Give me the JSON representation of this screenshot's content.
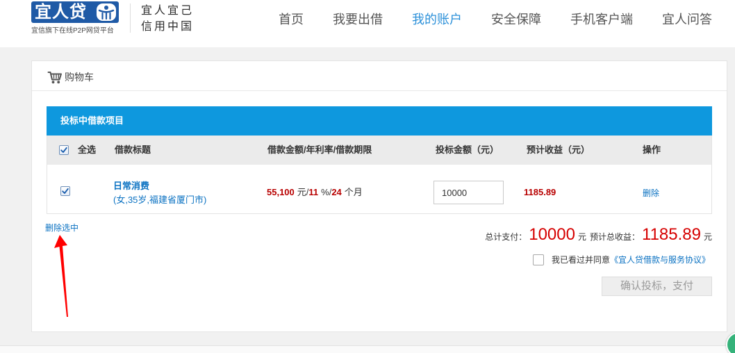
{
  "colors": {
    "brand": "#1f5aa6",
    "nav-active": "#2b90d9",
    "section-bar": "#0e98de",
    "link": "#0b72c2",
    "value-red": "#b80000",
    "big-red": "#d60000",
    "annotation-red": "#ff0000",
    "widget-green": "#35b27a"
  },
  "icons": {
    "logo": "people-logo-icon",
    "cart": "shopping-cart-icon",
    "checkbox": "checkmark-icon",
    "annotation": "red-arrow-icon",
    "widget": "floating-widget-icon"
  },
  "header": {
    "logo_text": "宜人贷",
    "logo_subtitle": "宜信旗下在线P2P网贷平台",
    "slogan_line1": "宜人宜己",
    "slogan_line2": "信用中国",
    "nav": [
      {
        "label": "首页",
        "active": false
      },
      {
        "label": "我要出借",
        "active": false
      },
      {
        "label": "我的账户",
        "active": true
      },
      {
        "label": "安全保障",
        "active": false
      },
      {
        "label": "手机客户端",
        "active": false
      },
      {
        "label": "宜人问答",
        "active": false
      }
    ]
  },
  "cart": {
    "title": "购物车",
    "section_title": "投标中借款项目",
    "select_all_checked": true,
    "columns": {
      "select_all": "全选",
      "title": "借款标题",
      "loan_info": "借款金额/年利率/借款期限",
      "bid_amount": "投标金额（元）",
      "expected_income": "预计收益（元）",
      "action": "操作"
    },
    "items": [
      {
        "checked": true,
        "title": "日常消费",
        "borrower": "(女,35岁,福建省厦门市)",
        "amount": "55,100",
        "amount_unit": "元/",
        "rate": "11",
        "rate_unit": "%/",
        "term": "24",
        "term_unit": "个月",
        "bid_value": "10000",
        "income": "1185.89",
        "action": "删除"
      }
    ],
    "delete_selected": "删除选中",
    "summary": {
      "total_pay_label": "总计支付：",
      "total_pay": "10000",
      "total_pay_unit": "元",
      "total_income_label": "预计总收益：",
      "total_income": "1185.89",
      "total_income_unit": "元"
    },
    "agreement": {
      "checked": false,
      "text": "我已看过并同意",
      "link": "《宜人贷借款与服务协议》"
    },
    "confirm_button": "确认投标，支付",
    "confirm_disabled": true
  }
}
